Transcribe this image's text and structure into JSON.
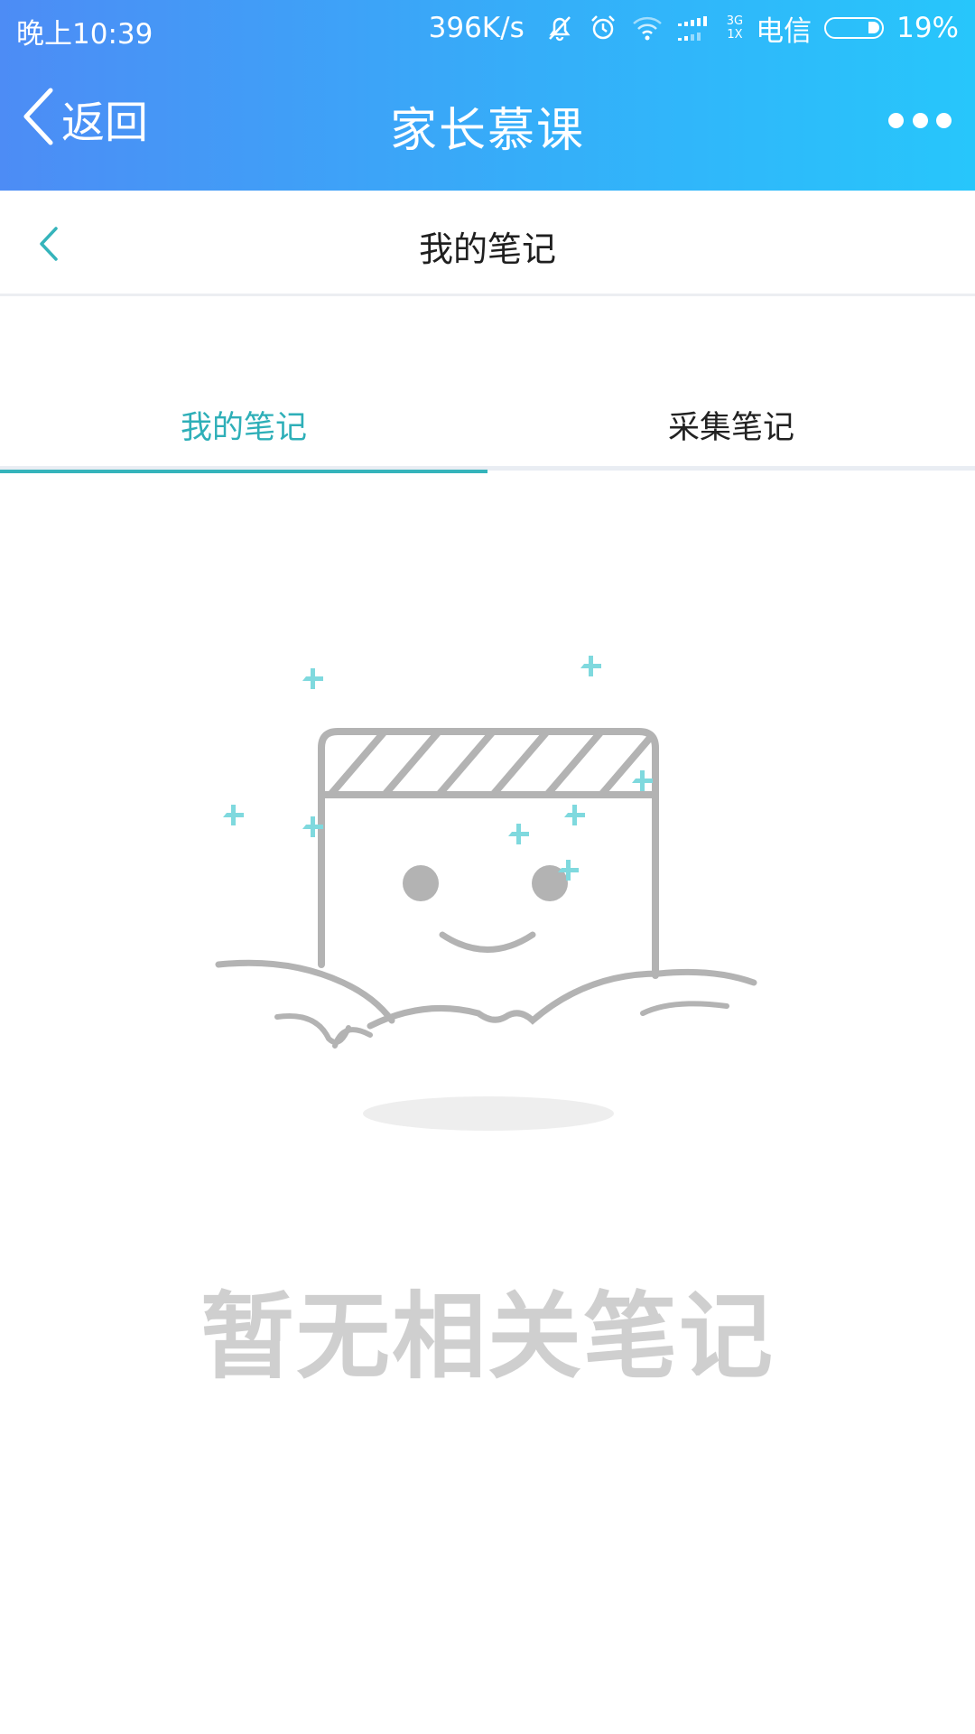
{
  "status_bar": {
    "time": "晚上10:39",
    "net_speed": "396K/s",
    "network_type_top": "3G",
    "network_type_bottom": "1X",
    "carrier": "电信",
    "battery_percent": "19%",
    "battery_level": 0.19
  },
  "nav": {
    "back_label": "返回",
    "title": "家长慕课"
  },
  "sub_header": {
    "title": "我的笔记"
  },
  "tabs": [
    {
      "label": "我的笔记",
      "active": true
    },
    {
      "label": "采集笔记",
      "active": false
    }
  ],
  "empty_state": {
    "message": "暂无相关笔记"
  },
  "colors": {
    "accent": "#35b4bb",
    "header_gradient_start": "#4d8cf5",
    "header_gradient_end": "#27c6fb",
    "sparkle": "#7fd9de",
    "illustration_stroke": "#b3b3b3",
    "empty_text": "#cfcfcf"
  }
}
